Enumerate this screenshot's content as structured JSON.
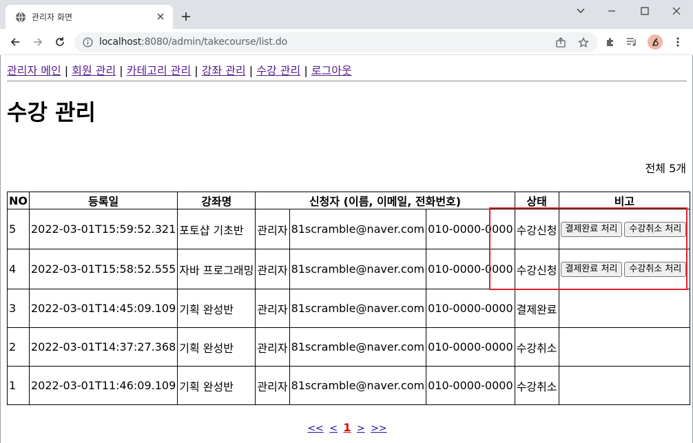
{
  "browser": {
    "tab_title": "관리자 화면",
    "url_host": "localhost",
    "url_rest": ":8080/admin/takecourse/list.do"
  },
  "menu": [
    {
      "label": "관리자 메인"
    },
    {
      "label": "회원 관리"
    },
    {
      "label": "카테고리 관리"
    },
    {
      "label": "강좌 관리"
    },
    {
      "label": "수강 관리"
    },
    {
      "label": "로그아웃"
    }
  ],
  "menu_separator": " | ",
  "page": {
    "title": "수강 관리",
    "total": "전체 5개"
  },
  "table": {
    "headers": [
      "NO",
      "등록일",
      "강좌명",
      "신청자 (이름, 이메일, 전화번호)",
      "상태",
      "비고"
    ],
    "rows": [
      {
        "no": "5",
        "date": "2022-03-01T15:59:52.321",
        "course": "포토샵 기초반",
        "name": "관리자",
        "email": "81scramble@naver.com",
        "phone": "010-0000-0000",
        "status": "수강신청",
        "btn_paid": "결제완료 처리",
        "btn_cancel": "수강취소 처리"
      },
      {
        "no": "4",
        "date": "2022-03-01T15:58:52.555",
        "course": "자바 프로그래밍",
        "name": "관리자",
        "email": "81scramble@naver.com",
        "phone": "010-0000-0000",
        "status": "수강신청",
        "btn_paid": "결제완료 처리",
        "btn_cancel": "수강취소 처리"
      },
      {
        "no": "3",
        "date": "2022-03-01T14:45:09.109",
        "course": "기획 완성반",
        "name": "관리자",
        "email": "81scramble@naver.com",
        "phone": "010-0000-0000",
        "status": "결제완료"
      },
      {
        "no": "2",
        "date": "2022-03-01T14:37:27.368",
        "course": "기획 완성반",
        "name": "관리자",
        "email": "81scramble@naver.com",
        "phone": "010-0000-0000",
        "status": "수강취소"
      },
      {
        "no": "1",
        "date": "2022-03-01T11:46:09.109",
        "course": "기획 완성반",
        "name": "관리자",
        "email": "81scramble@naver.com",
        "phone": "010-0000-0000",
        "status": "수강취소"
      }
    ]
  },
  "pager": {
    "first": "<<",
    "prev": "<",
    "current": "1",
    "next": ">",
    "last": ">>"
  },
  "colors": {
    "highlight": "#e0202a",
    "visited_link": "#551a8b",
    "current_page": "#e00000"
  }
}
